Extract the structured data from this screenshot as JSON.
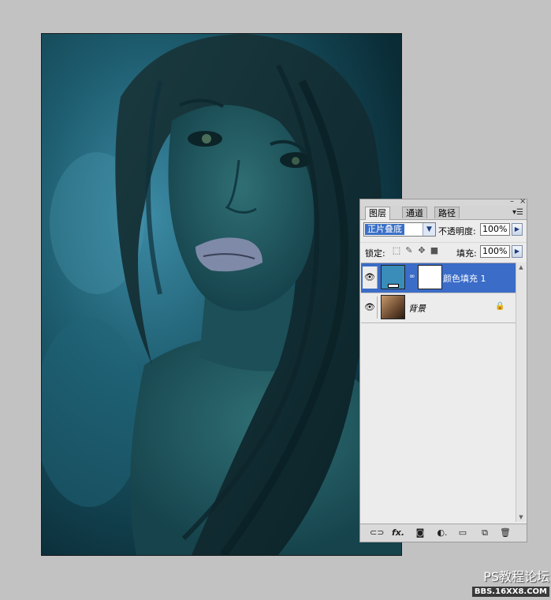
{
  "canvas": {
    "description_icon": "portrait-photo",
    "tint": "#1d5c6e"
  },
  "panel": {
    "tabs": [
      {
        "label": "图层",
        "active": true
      },
      {
        "label": "通道",
        "active": false
      },
      {
        "label": "路径",
        "active": false
      }
    ],
    "window_controls": {
      "minimize": "–",
      "close": "×"
    },
    "menu_icon": "panel-menu-icon",
    "blend_mode": "正片叠底",
    "opacity_label": "不透明度:",
    "opacity_value": "100%",
    "lock_label": "锁定:",
    "fill_label": "填充:",
    "fill_value": "100%",
    "layers": [
      {
        "name": "颜色填充 1",
        "selected": true,
        "fill_color": "#3a8db8",
        "has_mask": true
      },
      {
        "name": "背景",
        "selected": false,
        "locked": true
      }
    ],
    "bottom_icons": [
      "link-icon",
      "fx-icon",
      "mask-icon",
      "adjustment-icon",
      "folder-icon",
      "new-layer-icon",
      "trash-icon"
    ]
  },
  "watermark": {
    "title": "PS教程论坛",
    "url": "BBS.16XX8.COM"
  },
  "colors": {
    "background": "#c2c2c2",
    "selection": "#3a6cc8"
  }
}
